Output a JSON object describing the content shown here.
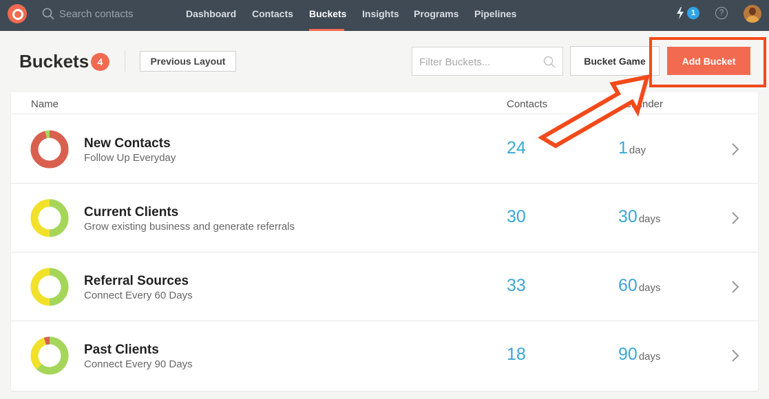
{
  "topnav": {
    "search_placeholder": "Search contacts",
    "nav_items": [
      "Dashboard",
      "Contacts",
      "Buckets",
      "Insights",
      "Programs",
      "Pipelines"
    ],
    "active_item": "Buckets",
    "notification_count": "1",
    "help_symbol": "?",
    "icons": [
      "logo",
      "search-icon",
      "bolt-icon",
      "help-icon",
      "avatar"
    ]
  },
  "header": {
    "title": "Buckets",
    "count": "4",
    "previous_layout_label": "Previous Layout",
    "filter_placeholder": "Filter Buckets...",
    "bucket_game_label": "Bucket Game",
    "add_bucket_label": "Add Bucket"
  },
  "table": {
    "columns": {
      "name": "Name",
      "contacts": "Contacts",
      "reminder": "Reminder"
    },
    "rows": [
      {
        "name": "New Contacts",
        "subtitle": "Follow Up Everyday",
        "contacts": "24",
        "reminder_num": "1",
        "reminder_unit": "day",
        "donut": [
          {
            "color": "#d9604f",
            "fraction": 0.96
          },
          {
            "color": "#a5d65a",
            "fraction": 0.04
          }
        ]
      },
      {
        "name": "Current Clients",
        "subtitle": "Grow existing business and generate referrals",
        "contacts": "30",
        "reminder_num": "30",
        "reminder_unit": "days",
        "donut": [
          {
            "color": "#a5d65a",
            "fraction": 0.5
          },
          {
            "color": "#f2e12a",
            "fraction": 0.5
          }
        ]
      },
      {
        "name": "Referral Sources",
        "subtitle": "Connect Every 60 Days",
        "contacts": "33",
        "reminder_num": "60",
        "reminder_unit": "days",
        "donut": [
          {
            "color": "#a5d65a",
            "fraction": 0.5
          },
          {
            "color": "#f2e12a",
            "fraction": 0.5
          }
        ]
      },
      {
        "name": "Past Clients",
        "subtitle": "Connect Every 90 Days",
        "contacts": "18",
        "reminder_num": "90",
        "reminder_unit": "days",
        "donut": [
          {
            "color": "#a5d65a",
            "fraction": 0.62
          },
          {
            "color": "#f2e12a",
            "fraction": 0.33
          },
          {
            "color": "#d9604f",
            "fraction": 0.05
          }
        ]
      }
    ]
  },
  "colors": {
    "nav_bg": "#3f4a55",
    "accent": "#f26a4f",
    "link_blue": "#3ba6d6",
    "highlight": "#f24a1a"
  }
}
